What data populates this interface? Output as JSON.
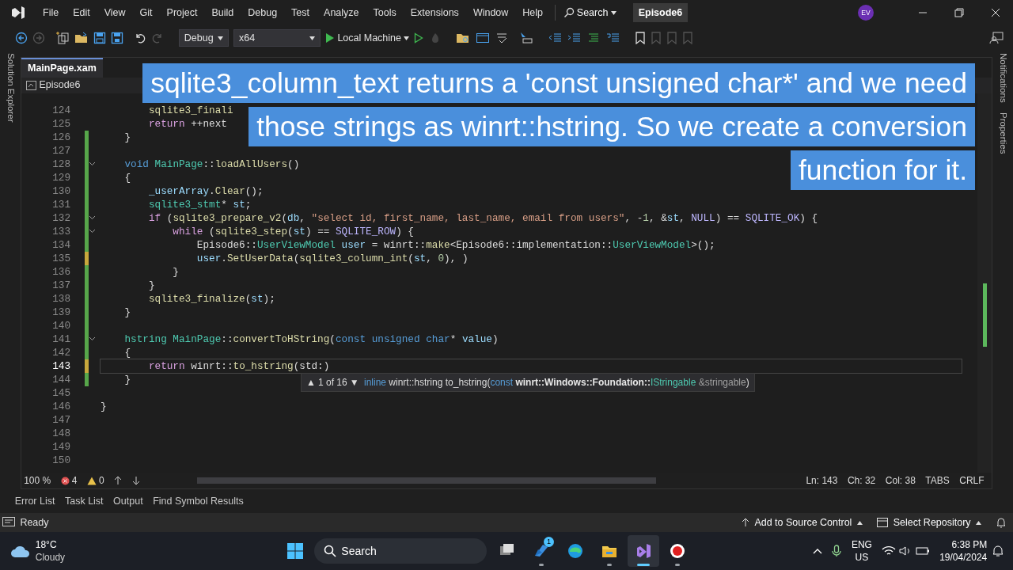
{
  "menu": [
    "File",
    "Edit",
    "View",
    "Git",
    "Project",
    "Build",
    "Debug",
    "Test",
    "Analyze",
    "Tools",
    "Extensions",
    "Window",
    "Help"
  ],
  "search": {
    "label": "Search"
  },
  "solution_name": "Episode6",
  "avatar": "EV",
  "toolbar": {
    "configuration": "Debug",
    "platform": "x64",
    "run_target": "Local Machine"
  },
  "left_panel": {
    "label": "Solution Explorer"
  },
  "right_panel": [
    "Notifications",
    "Properties"
  ],
  "editor": {
    "tab": "MainPage.xam",
    "project": "Episode6",
    "lines": [
      {
        "number": "124",
        "fold": false,
        "current": false,
        "tokens": [
          {
            "text": "        sqlite3_finali",
            "kind": "fn"
          }
        ]
      },
      {
        "number": "125",
        "fold": false,
        "current": false,
        "tokens": [
          {
            "text": "        return",
            "kind": "ctrl"
          },
          {
            "text": " ++next",
            "kind": "plain"
          }
        ]
      },
      {
        "number": "126",
        "color": "#57a64a",
        "fold": false,
        "current": false,
        "tokens": [
          {
            "text": "    }",
            "kind": "plain"
          }
        ]
      },
      {
        "number": "127",
        "color": "#57a64a",
        "fold": false,
        "current": false
      },
      {
        "number": "128",
        "color": "#57a64a",
        "fold": true,
        "current": false,
        "tokens": [
          {
            "text": "    void",
            "kind": "kw"
          },
          {
            "text": " MainPage",
            "kind": "type"
          },
          {
            "text": "::",
            "kind": "plain"
          },
          {
            "text": "loadAllUsers",
            "kind": "fn"
          },
          {
            "text": "()",
            "kind": "plain"
          }
        ]
      },
      {
        "number": "129",
        "color": "#57a64a",
        "fold": false,
        "current": false,
        "tokens": [
          {
            "text": "    {",
            "kind": "plain"
          }
        ]
      },
      {
        "number": "130",
        "color": "#57a64a",
        "fold": false,
        "current": false,
        "tokens": [
          {
            "text": "        _userArray",
            "kind": "var"
          },
          {
            "text": ".",
            "kind": "plain"
          },
          {
            "text": "Clear",
            "kind": "fn"
          },
          {
            "text": "();",
            "kind": "plain"
          }
        ]
      },
      {
        "number": "131",
        "color": "#57a64a",
        "fold": false,
        "current": false,
        "tokens": [
          {
            "text": "        sqlite3_stmt",
            "kind": "type"
          },
          {
            "text": "* ",
            "kind": "plain"
          },
          {
            "text": "st",
            "kind": "var"
          },
          {
            "text": ";",
            "kind": "plain"
          }
        ]
      },
      {
        "number": "132",
        "color": "#57a64a",
        "fold": true,
        "current": false,
        "tokens": [
          {
            "text": "        if",
            "kind": "ctrl"
          },
          {
            "text": " (",
            "kind": "plain"
          },
          {
            "text": "sqlite3_prepare_v2",
            "kind": "fn"
          },
          {
            "text": "(",
            "kind": "plain"
          },
          {
            "text": "db",
            "kind": "var"
          },
          {
            "text": ", ",
            "kind": "plain"
          },
          {
            "text": "\"select id, first_name, last_name, email from users\"",
            "kind": "str"
          },
          {
            "text": ", -",
            "kind": "plain"
          },
          {
            "text": "1",
            "kind": "num"
          },
          {
            "text": ", &",
            "kind": "plain"
          },
          {
            "text": "st",
            "kind": "var"
          },
          {
            "text": ", ",
            "kind": "plain"
          },
          {
            "text": "NULL",
            "kind": "macro"
          },
          {
            "text": ") == ",
            "kind": "plain"
          },
          {
            "text": "SQLITE_OK",
            "kind": "macro"
          },
          {
            "text": ") {",
            "kind": "plain"
          }
        ]
      },
      {
        "number": "133",
        "color": "#57a64a",
        "fold": true,
        "current": false,
        "tokens": [
          {
            "text": "            while",
            "kind": "ctrl"
          },
          {
            "text": " (",
            "kind": "plain"
          },
          {
            "text": "sqlite3_step",
            "kind": "fn"
          },
          {
            "text": "(",
            "kind": "plain"
          },
          {
            "text": "st",
            "kind": "var"
          },
          {
            "text": ") == ",
            "kind": "plain"
          },
          {
            "text": "SQLITE_ROW",
            "kind": "macro"
          },
          {
            "text": ") {",
            "kind": "plain"
          }
        ]
      },
      {
        "number": "134",
        "color": "#57a64a",
        "fold": false,
        "current": false,
        "tokens": [
          {
            "text": "                Episode6::",
            "kind": "plain"
          },
          {
            "text": "UserViewModel",
            "kind": "type"
          },
          {
            "text": " user",
            "kind": "var"
          },
          {
            "text": " = winrt::",
            "kind": "plain"
          },
          {
            "text": "make",
            "kind": "fn"
          },
          {
            "text": "<Episode6::implementation::",
            "kind": "plain"
          },
          {
            "text": "UserViewModel",
            "kind": "type"
          },
          {
            "text": ">();",
            "kind": "plain"
          }
        ]
      },
      {
        "number": "135",
        "color": "#c8a83c",
        "fold": false,
        "current": false,
        "tokens": [
          {
            "text": "                user",
            "kind": "var"
          },
          {
            "text": ".",
            "kind": "plain"
          },
          {
            "text": "SetUserData",
            "kind": "fn"
          },
          {
            "text": "(",
            "kind": "plain"
          },
          {
            "text": "sqlite3_column_int",
            "kind": "fn"
          },
          {
            "text": "(",
            "kind": "plain"
          },
          {
            "text": "st",
            "kind": "var"
          },
          {
            "text": ", ",
            "kind": "plain"
          },
          {
            "text": "0",
            "kind": "num"
          },
          {
            "text": "), )",
            "kind": "plain"
          }
        ]
      },
      {
        "number": "136",
        "color": "#57a64a",
        "fold": false,
        "current": false,
        "tokens": [
          {
            "text": "            }",
            "kind": "plain"
          }
        ]
      },
      {
        "number": "137",
        "color": "#57a64a",
        "fold": false,
        "current": false,
        "tokens": [
          {
            "text": "        }",
            "kind": "plain"
          }
        ]
      },
      {
        "number": "138",
        "color": "#57a64a",
        "fold": false,
        "current": false,
        "tokens": [
          {
            "text": "        sqlite3_finalize",
            "kind": "fn"
          },
          {
            "text": "(",
            "kind": "plain"
          },
          {
            "text": "st",
            "kind": "var"
          },
          {
            "text": ");",
            "kind": "plain"
          }
        ]
      },
      {
        "number": "139",
        "color": "#57a64a",
        "fold": false,
        "current": false,
        "tokens": [
          {
            "text": "    }",
            "kind": "plain"
          }
        ]
      },
      {
        "number": "140",
        "color": "#57a64a",
        "fold": false,
        "current": false
      },
      {
        "number": "141",
        "color": "#57a64a",
        "fold": true,
        "current": false,
        "tokens": [
          {
            "text": "    hstring",
            "kind": "type"
          },
          {
            "text": " MainPage",
            "kind": "type"
          },
          {
            "text": "::",
            "kind": "plain"
          },
          {
            "text": "convertToHString",
            "kind": "fn"
          },
          {
            "text": "(",
            "kind": "plain"
          },
          {
            "text": "const unsigned char",
            "kind": "kw"
          },
          {
            "text": "* ",
            "kind": "plain"
          },
          {
            "text": "value",
            "kind": "var"
          },
          {
            "text": ")",
            "kind": "plain"
          }
        ]
      },
      {
        "number": "142",
        "color": "#57a64a",
        "fold": false,
        "current": false,
        "tokens": [
          {
            "text": "    {",
            "kind": "plain"
          }
        ]
      },
      {
        "number": "143",
        "color": "#c8a83c",
        "fold": false,
        "current": true,
        "tokens": [
          {
            "text": "        return",
            "kind": "ctrl"
          },
          {
            "text": " winrt::",
            "kind": "plain"
          },
          {
            "text": "to_hstring",
            "kind": "fn"
          },
          {
            "text": "(std:)",
            "kind": "plain"
          }
        ]
      },
      {
        "number": "144",
        "color": "#57a64a",
        "fold": false,
        "current": false,
        "tokens": [
          {
            "text": "    }",
            "kind": "plain"
          }
        ]
      },
      {
        "number": "145",
        "fold": false,
        "current": false
      },
      {
        "number": "146",
        "fold": false,
        "current": false,
        "tokens": [
          {
            "text": "}",
            "kind": "plain"
          }
        ]
      },
      {
        "number": "147",
        "fold": false,
        "current": false
      },
      {
        "number": "148",
        "fold": false,
        "current": false
      },
      {
        "number": "149",
        "fold": false,
        "current": false
      },
      {
        "number": "150",
        "fold": false,
        "current": false
      }
    ]
  },
  "parameter_info": {
    "up": "▲",
    "position": "1 of 16",
    "down": "▼",
    "signature": [
      {
        "text": "inline ",
        "kind": "kw"
      },
      {
        "text": "winrt::hstring to_hstring(",
        "kind": "plain"
      },
      {
        "text": "const ",
        "kind": "kw"
      },
      {
        "text": "winrt::Windows::Foundation::",
        "kind": "bold"
      },
      {
        "text": "IStringable ",
        "kind": "type"
      },
      {
        "text": "&stringable",
        "kind": "param"
      },
      {
        "text": ")",
        "kind": "plain"
      }
    ]
  },
  "caption": [
    "sqlite3_column_text returns a 'const unsigned char*' and we need",
    "those strings as winrt::hstring. So we create a conversion",
    "function for it."
  ],
  "editor_status": {
    "zoom": "100 %",
    "errors": "4",
    "warnings": "0",
    "line": "Ln: 143",
    "char": "Ch: 32",
    "col": "Col: 38",
    "indent": "TABS",
    "eol": "CRLF"
  },
  "tool_tabs": [
    "Error List",
    "Task List",
    "Output",
    "Find Symbol Results"
  ],
  "status_bar": {
    "text": "Ready",
    "source_control": "Add to Source Control",
    "repository": "Select Repository"
  },
  "taskbar": {
    "temperature": "18°C",
    "weather": "Cloudy",
    "search": "Search",
    "apps": [
      {
        "kind": "taskview",
        "running": false,
        "active": false
      },
      {
        "kind": "blueapp",
        "running": true,
        "active": false,
        "badge": "1"
      },
      {
        "kind": "browser",
        "running": false,
        "active": false
      },
      {
        "kind": "folder",
        "running": true,
        "active": false
      },
      {
        "kind": "vs",
        "running": true,
        "active": true
      },
      {
        "kind": "record",
        "running": true,
        "active": false
      }
    ],
    "language": "ENG",
    "region": "US",
    "time": "6:38 PM",
    "date": "19/04/2024"
  }
}
